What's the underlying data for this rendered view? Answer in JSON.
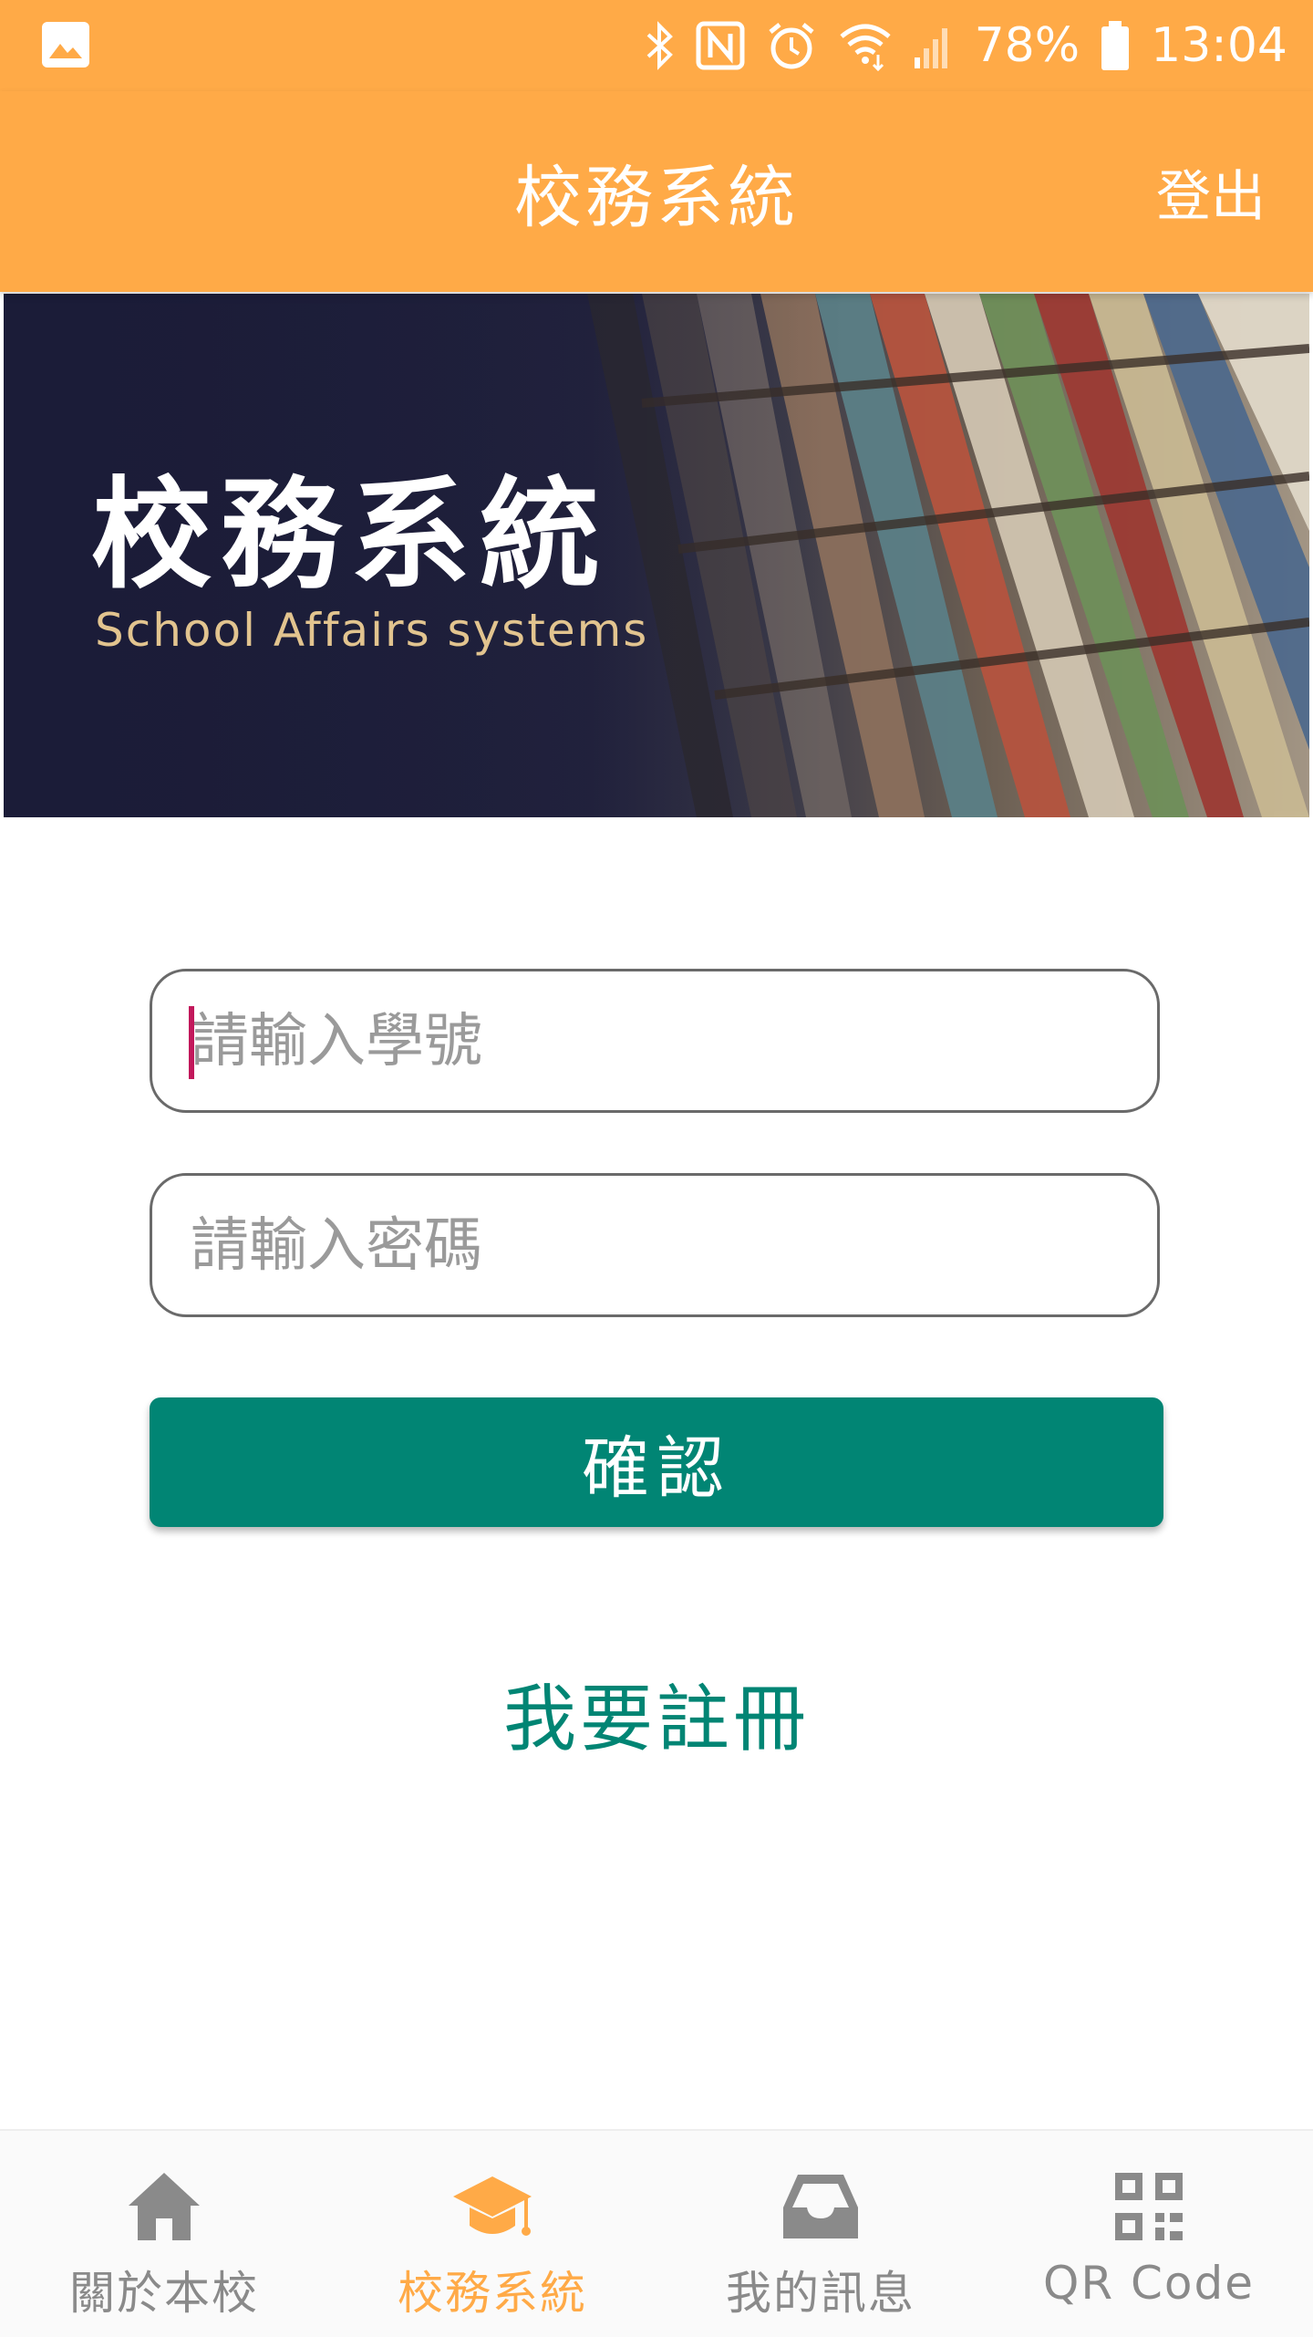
{
  "status_bar": {
    "battery": "78%",
    "time": "13:04"
  },
  "app_bar": {
    "title": "校務系統",
    "logout_label": "登出"
  },
  "banner": {
    "title": "校務系統",
    "subtitle": "School Affairs systems"
  },
  "form": {
    "student_id_placeholder": "請輸入學號",
    "password_placeholder": "請輸入密碼",
    "confirm_label": "確認",
    "register_label": "我要註冊"
  },
  "bottom_nav": {
    "items": [
      {
        "label": "關於本校",
        "icon": "home-icon"
      },
      {
        "label": "校務系統",
        "icon": "graduation-cap-icon",
        "active": true
      },
      {
        "label": "我的訊息",
        "icon": "inbox-icon"
      },
      {
        "label": "QR Code",
        "icon": "qr-code-icon"
      }
    ]
  },
  "colors": {
    "primary_orange": "#FFAA47",
    "accent_teal": "#018574",
    "inactive_gray": "#8a8a8a"
  }
}
